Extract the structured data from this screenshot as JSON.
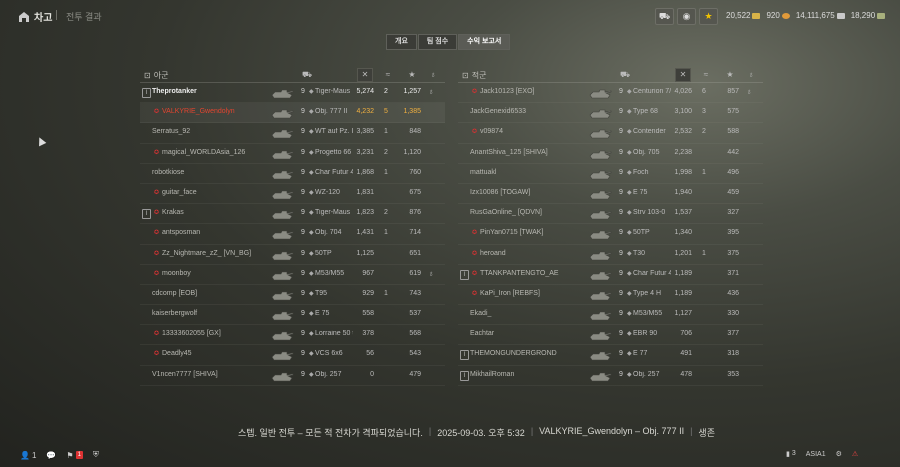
{
  "topbar": {
    "garage_label": "차고",
    "battle_results_label": "전투 결과",
    "icons": [
      "tank-icon",
      "bonds-icon",
      "premium-star-icon"
    ],
    "currency": {
      "gold": "20,522",
      "bonds": "920",
      "credits": "14,111,675",
      "free_xp": "18,290"
    }
  },
  "tabs": [
    "개요",
    "팀 점수",
    "수익 보고서"
  ],
  "active_tab": 2,
  "ally": {
    "title": "아군",
    "players": [
      {
        "name": "Theprotanker",
        "tier": "9",
        "tank": "Tiger-Maus",
        "damage": "5,274",
        "kills": "2",
        "xp": "1,257",
        "badge": true,
        "medal": true,
        "bold": true
      },
      {
        "name": "VALKYRIE_Gwendolyn",
        "tier": "9",
        "tank": "Obj. 777 II",
        "damage": "4,232",
        "kills": "5",
        "xp": "1,385",
        "clan": true,
        "red": true,
        "me": true
      },
      {
        "name": "Serratus_92",
        "tier": "9",
        "tank": "WT auf Pz. IV",
        "damage": "3,385",
        "kills": "1",
        "xp": "848"
      },
      {
        "name": "magical_WORLDAsia_126",
        "tier": "9",
        "tank": "Progetto 66",
        "damage": "3,231",
        "kills": "2",
        "xp": "1,120",
        "clan": true
      },
      {
        "name": "robotkiose",
        "tier": "9",
        "tank": "Char Futur 4",
        "damage": "1,868",
        "kills": "1",
        "xp": "760"
      },
      {
        "name": "guitar_face",
        "tier": "9",
        "tank": "WZ-120",
        "damage": "1,831",
        "kills": "",
        "xp": "675",
        "clan": true
      },
      {
        "name": "Krakas",
        "tier": "9",
        "tank": "Tiger-Maus",
        "damage": "1,823",
        "kills": "2",
        "xp": "876",
        "badge": true,
        "clan": true
      },
      {
        "name": "antsposman",
        "tier": "9",
        "tank": "Obj. 704",
        "damage": "1,431",
        "kills": "1",
        "xp": "714",
        "clan": true
      },
      {
        "name": "Zz_Nightmare_zZ_ [VN_BG]",
        "tier": "9",
        "tank": "50TP",
        "damage": "1,125",
        "kills": "",
        "xp": "651",
        "clan": true
      },
      {
        "name": "moonboy",
        "tier": "9",
        "tank": "M53/M55",
        "damage": "967",
        "kills": "",
        "xp": "619",
        "clan": true,
        "medal": true
      },
      {
        "name": "cdcomp [EOB]",
        "tier": "9",
        "tank": "T95",
        "damage": "929",
        "kills": "1",
        "xp": "743"
      },
      {
        "name": "kaiserbergwolf",
        "tier": "9",
        "tank": "E 75",
        "damage": "558",
        "kills": "",
        "xp": "537"
      },
      {
        "name": "13333602055 [GX]",
        "tier": "9",
        "tank": "Lorraine 50 t",
        "damage": "378",
        "kills": "",
        "xp": "568",
        "clan": true
      },
      {
        "name": "Deadly45",
        "tier": "9",
        "tank": "VCS 6x6",
        "damage": "56",
        "kills": "",
        "xp": "543",
        "clan": true
      },
      {
        "name": "V1ncen7777 [SHIVA]",
        "tier": "9",
        "tank": "Obj. 257",
        "damage": "0",
        "kills": "",
        "xp": "479"
      }
    ]
  },
  "enemy": {
    "title": "적군",
    "players": [
      {
        "name": "Jack10123 [EXO]",
        "tier": "9",
        "tank": "Centurion 7/1",
        "damage": "4,026",
        "kills": "6",
        "xp": "857",
        "clan": true,
        "medal": true
      },
      {
        "name": "JackGenexid6533",
        "tier": "9",
        "tank": "Type 68",
        "damage": "3,100",
        "kills": "3",
        "xp": "575"
      },
      {
        "name": "v09874",
        "tier": "9",
        "tank": "Contender",
        "damage": "2,532",
        "kills": "2",
        "xp": "588",
        "clan": true
      },
      {
        "name": "AnantShiva_125 [SHIVA]",
        "tier": "9",
        "tank": "Obj. 705",
        "damage": "2,238",
        "kills": "",
        "xp": "442"
      },
      {
        "name": "mattuakl",
        "tier": "9",
        "tank": "Foch",
        "damage": "1,998",
        "kills": "1",
        "xp": "496"
      },
      {
        "name": "Izx10086 [TOGAW]",
        "tier": "9",
        "tank": "E 75",
        "damage": "1,940",
        "kills": "",
        "xp": "459"
      },
      {
        "name": "RusGaOnline_ [QDVN]",
        "tier": "9",
        "tank": "Strv 103-0",
        "damage": "1,537",
        "kills": "",
        "xp": "327"
      },
      {
        "name": "PinYan0715 [TWAK]",
        "tier": "9",
        "tank": "50TP",
        "damage": "1,340",
        "kills": "",
        "xp": "395",
        "clan": true
      },
      {
        "name": "heroand",
        "tier": "9",
        "tank": "T30",
        "damage": "1,201",
        "kills": "1",
        "xp": "375",
        "clan": true
      },
      {
        "name": "TTANKPANTENGTO_AE",
        "tier": "9",
        "tank": "Char Futur 4",
        "damage": "1,189",
        "kills": "",
        "xp": "371",
        "badge": true,
        "clan": true
      },
      {
        "name": "KaPi_Iron [REBFS]",
        "tier": "9",
        "tank": "Type 4 H",
        "damage": "1,189",
        "kills": "",
        "xp": "436",
        "clan": true
      },
      {
        "name": "Ekadi_",
        "tier": "9",
        "tank": "M53/M55",
        "damage": "1,127",
        "kills": "",
        "xp": "330"
      },
      {
        "name": "Eachtar",
        "tier": "9",
        "tank": "EBR 90",
        "damage": "706",
        "kills": "",
        "xp": "377"
      },
      {
        "name": "THEMONGUNDERGROND",
        "tier": "9",
        "tank": "E 77",
        "damage": "491",
        "kills": "",
        "xp": "318",
        "badge": true
      },
      {
        "name": "MikhailRoman",
        "tier": "9",
        "tank": "Obj. 257",
        "damage": "478",
        "kills": "",
        "xp": "353",
        "badge": true
      }
    ]
  },
  "footer": {
    "mode": "스텝. 일반 전투 – 모든 적 전차가 격파되었습니다.",
    "datetime": "2025-09-03. 오후 5:32",
    "player_vehicle": "VALKYRIE_Gwendolyn – Obj. 777 II",
    "status": "생존"
  },
  "bottombar": {
    "friends_count": "1",
    "notification_count": "1",
    "region": "ASIA1",
    "sessions": "3"
  }
}
